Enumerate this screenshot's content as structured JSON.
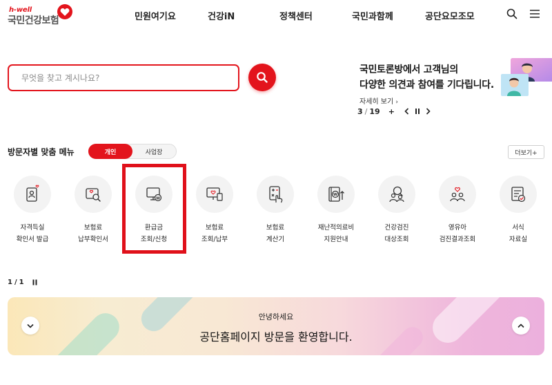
{
  "header": {
    "logo_small": "h-well",
    "logo_main": "국민건강보험",
    "nav": [
      "민원여기요",
      "건강iN",
      "정책센터",
      "국민과함께",
      "공단요모조모"
    ]
  },
  "search": {
    "placeholder": "무엇을 찾고 계시나요?"
  },
  "promo": {
    "line1": "국민토론방에서 고객님의",
    "line2": "다양한 의견과 참여를 기다립니다.",
    "more": "자세히 보기",
    "current": "3",
    "total": "19",
    "add": "+"
  },
  "menu": {
    "title": "방문자별 맞춤 메뉴",
    "tabs": [
      "개인",
      "사업장"
    ],
    "more_label": "더보기+",
    "items": [
      {
        "line1": "자격득실",
        "line2": "확인서 발급",
        "icon": "id-card-heart-icon"
      },
      {
        "line1": "보험료",
        "line2": "납부확인서",
        "icon": "document-search-icon"
      },
      {
        "line1": "환급금",
        "line2": "조회/신청",
        "icon": "monitor-coin-icon"
      },
      {
        "line1": "보험료",
        "line2": "조회/납부",
        "icon": "monitor-heart-card-icon"
      },
      {
        "line1": "보험료",
        "line2": "계산기",
        "icon": "calculator-hand-icon"
      },
      {
        "line1": "재난적의료비",
        "line2": "지원안내",
        "icon": "cabinet-coin-arrow-icon"
      },
      {
        "line1": "건강검진",
        "line2": "대상조회",
        "icon": "person-search-icon"
      },
      {
        "line1": "영유아",
        "line2": "검진결과조회",
        "icon": "family-heart-icon"
      },
      {
        "line1": "서식",
        "line2": "자료실",
        "icon": "form-check-icon"
      }
    ],
    "page_current": "1",
    "page_total": "1"
  },
  "banner": {
    "sub": "안녕하세요",
    "main": "공단홈페이지 방문을 환영합니다."
  },
  "colors": {
    "brand_red": "#e3141c"
  }
}
